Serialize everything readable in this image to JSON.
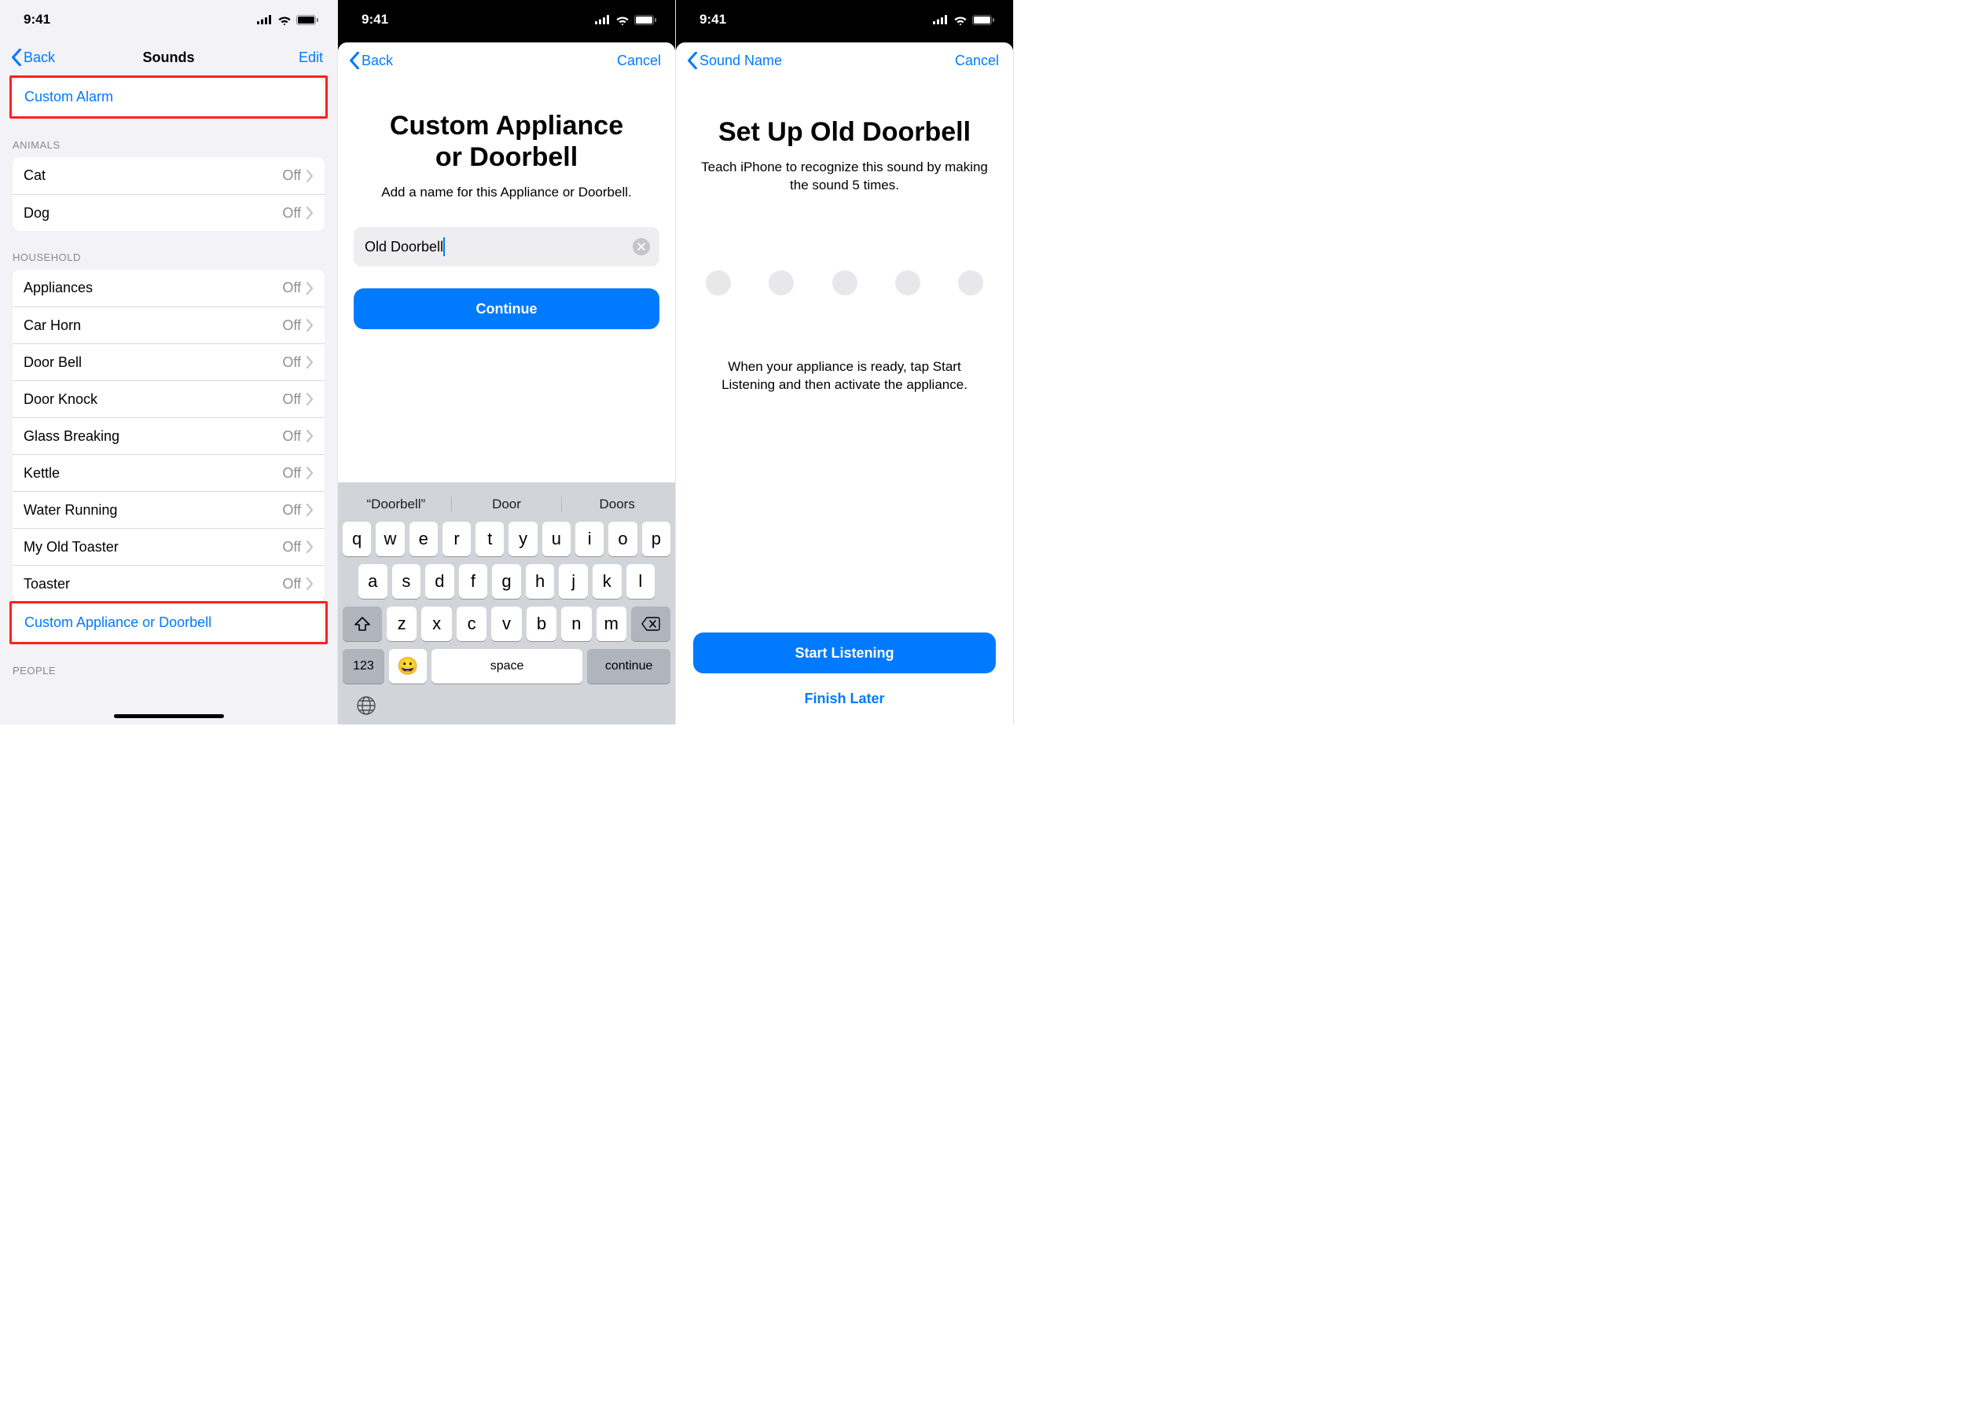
{
  "status": {
    "time": "9:41"
  },
  "screen1": {
    "nav": {
      "back": "Back",
      "title": "Sounds",
      "action": "Edit"
    },
    "custom_alarm": "Custom Alarm",
    "off_label": "Off",
    "groups": {
      "animals": {
        "header": "ANIMALS",
        "items": [
          "Cat",
          "Dog"
        ]
      },
      "household": {
        "header": "HOUSEHOLD",
        "items": [
          "Appliances",
          "Car Horn",
          "Door Bell",
          "Door Knock",
          "Glass Breaking",
          "Kettle",
          "Water Running",
          "My Old Toaster",
          "Toaster"
        ]
      },
      "people": {
        "header": "PEOPLE"
      }
    },
    "custom_appliance": "Custom Appliance or Doorbell"
  },
  "screen2": {
    "nav": {
      "back": "Back",
      "cancel": "Cancel"
    },
    "title_l1": "Custom Appliance",
    "title_l2": "or Doorbell",
    "subtitle": "Add a name for this Appliance or Doorbell.",
    "input_value": "Old Doorbell",
    "continue": "Continue",
    "candidates": [
      "“Doorbell”",
      "Door",
      "Doors"
    ],
    "kb": {
      "r1": [
        "q",
        "w",
        "e",
        "r",
        "t",
        "y",
        "u",
        "i",
        "o",
        "p"
      ],
      "r2": [
        "a",
        "s",
        "d",
        "f",
        "g",
        "h",
        "j",
        "k",
        "l"
      ],
      "r3": [
        "z",
        "x",
        "c",
        "v",
        "b",
        "n",
        "m"
      ],
      "space": "space",
      "cont": "continue",
      "num": "123"
    }
  },
  "screen3": {
    "nav": {
      "back": "Sound Name",
      "cancel": "Cancel"
    },
    "title": "Set Up Old Doorbell",
    "subtitle": "Teach iPhone to recognize this sound by making the sound 5 times.",
    "instruction": "When your appliance is ready, tap Start Listening and then activate the appliance.",
    "start": "Start Listening",
    "finish_later": "Finish Later"
  }
}
